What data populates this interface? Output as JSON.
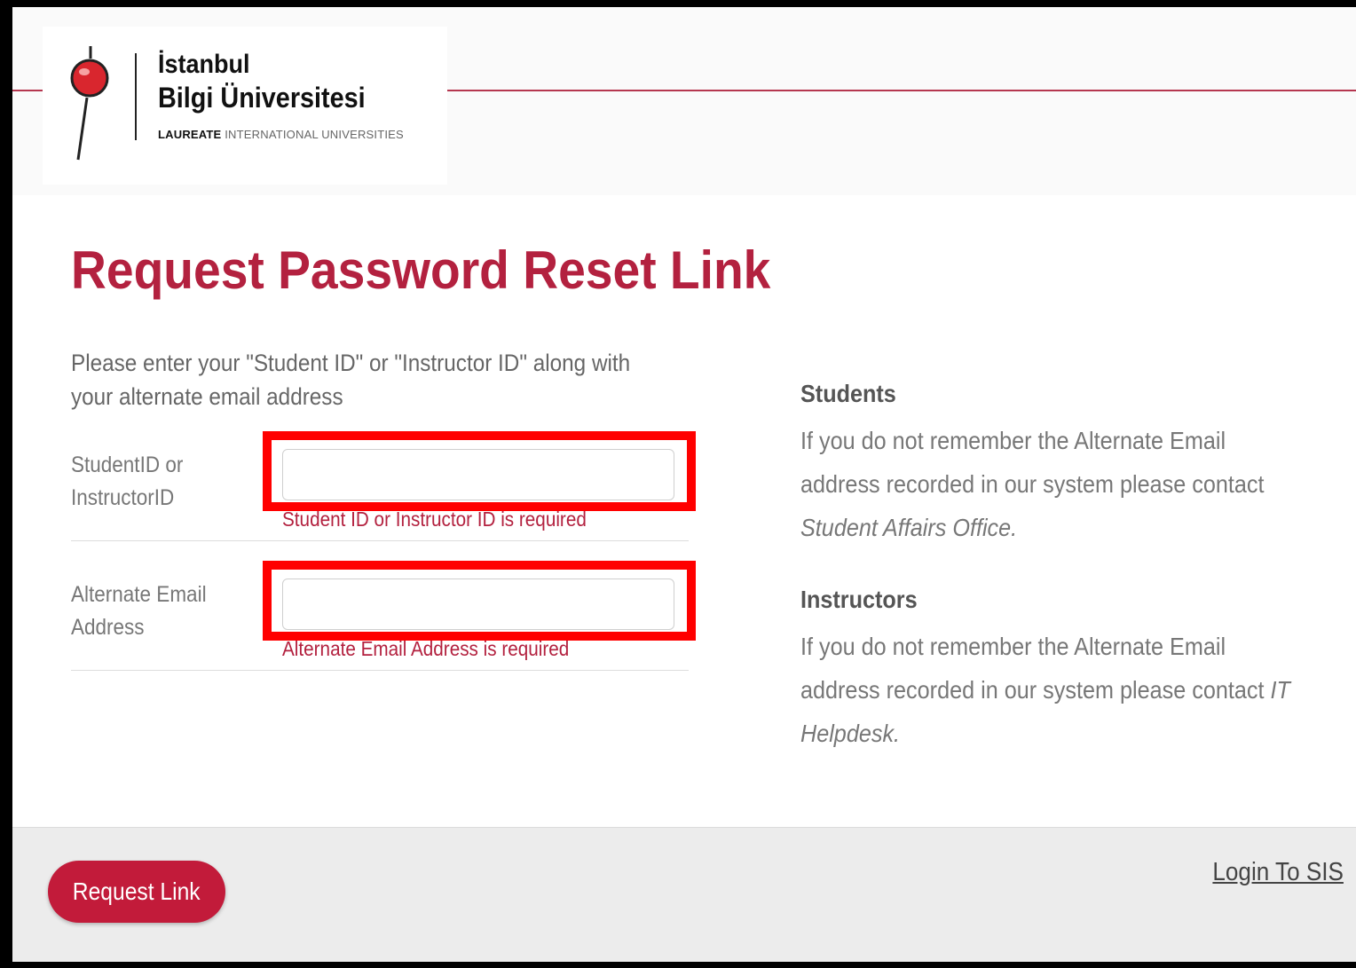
{
  "header": {
    "logo": {
      "line1": "İstanbul",
      "line2": "Bilgi Üniversitesi",
      "tag_bold": "LAUREATE",
      "tag_rest": " INTERNATIONAL UNIVERSITIES"
    }
  },
  "page": {
    "title": "Request Password Reset Link",
    "intro": "Please enter your \"Student ID\" or \"Instructor ID\" along with your alternate email address"
  },
  "form": {
    "id_field": {
      "label": "StudentID or InstructorID",
      "value": "",
      "error": "Student ID or Instructor ID is required"
    },
    "email_field": {
      "label": "Alternate Email Address",
      "value": "",
      "error": "Alternate Email Address is required"
    }
  },
  "sidebar": {
    "students": {
      "heading": "Students",
      "text": "If you do not remember the Alternate Email address recorded in our system please contact ",
      "contact": "Student Affairs Office."
    },
    "instructors": {
      "heading": "Instructors",
      "text": "If you do not remember the Alternate Email address recorded in our system please contact ",
      "contact": "IT Helpdesk."
    }
  },
  "footer": {
    "request_button": "Request Link",
    "login_link": "Login To SIS"
  },
  "colors": {
    "brand_red": "#b3213f",
    "highlight_red": "#ff0000",
    "button_red": "#c21b3a"
  },
  "icons": {
    "logo": "bilgi-logo-icon"
  }
}
